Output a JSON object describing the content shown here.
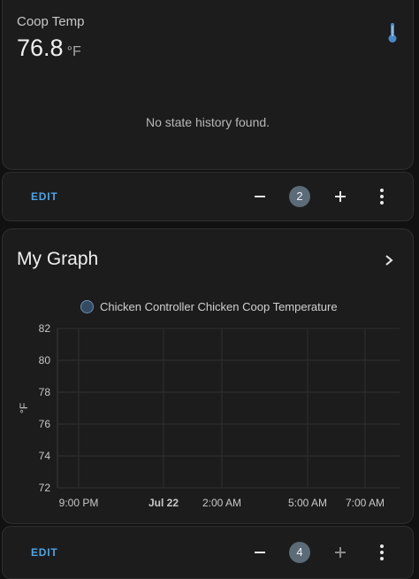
{
  "sensor_card": {
    "name": "Coop Temp",
    "value": "76.8",
    "unit": "°F",
    "icon": "thermometer-icon",
    "empty_message": "No state history found."
  },
  "toolbar_1": {
    "edit_label": "EDIT",
    "count": "2"
  },
  "graph_card": {
    "title": "My Graph",
    "legend_label": "Chicken Controller Chicken Coop Temperature"
  },
  "toolbar_2": {
    "edit_label": "EDIT",
    "count": "4"
  },
  "colors": {
    "accent": "#4fa3e3",
    "series": "#6f8fb0",
    "badge": "#5b6b77"
  },
  "chart_data": {
    "type": "line",
    "ylabel": "°F",
    "ylim": [
      72,
      82
    ],
    "y_ticks": [
      "82",
      "80",
      "78",
      "76",
      "74",
      "72"
    ],
    "x_ticks": [
      "9:00 PM",
      "Jul 22",
      "2:00 AM",
      "5:00 AM",
      "7:00 AM"
    ],
    "series": [
      {
        "name": "Chicken Controller Chicken Coop Temperature",
        "values": []
      }
    ]
  }
}
